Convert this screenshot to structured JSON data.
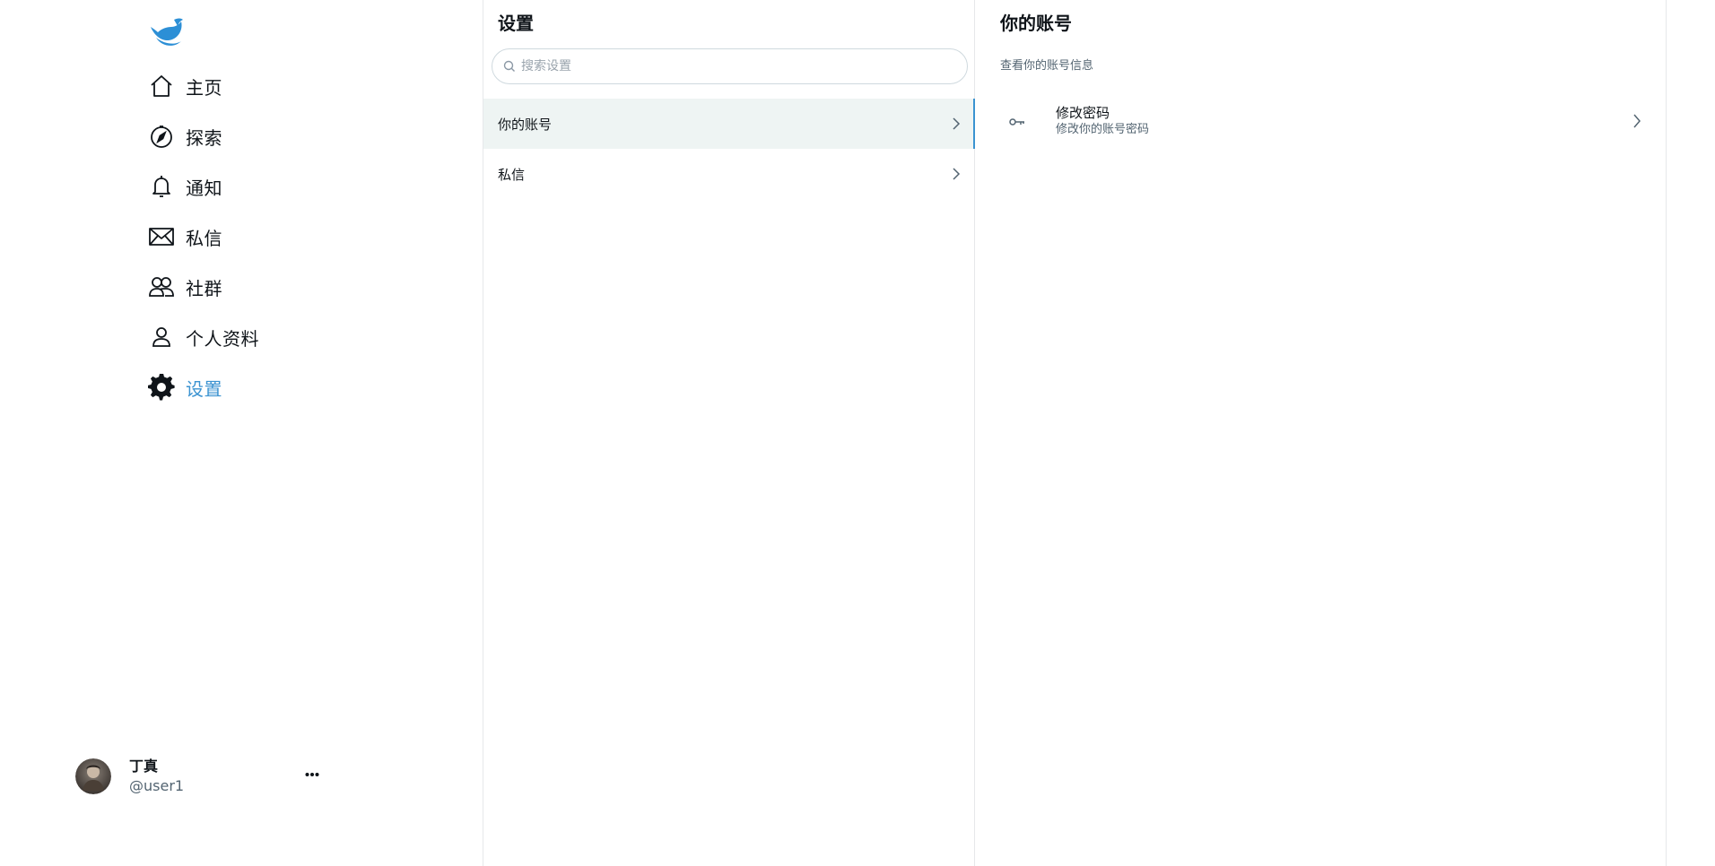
{
  "sidebar": {
    "nav": [
      {
        "label": "主页",
        "icon": "home-icon"
      },
      {
        "label": "探索",
        "icon": "compass-icon"
      },
      {
        "label": "通知",
        "icon": "bell-icon"
      },
      {
        "label": "私信",
        "icon": "mail-icon"
      },
      {
        "label": "社群",
        "icon": "community-icon"
      },
      {
        "label": "个人资料",
        "icon": "profile-icon"
      },
      {
        "label": "设置",
        "icon": "gear-icon",
        "active": true
      }
    ],
    "user": {
      "name": "丁真",
      "handle": "@user1"
    }
  },
  "settings": {
    "title": "设置",
    "search_placeholder": "搜索设置",
    "items": [
      {
        "label": "你的账号",
        "active": true
      },
      {
        "label": "私信"
      }
    ]
  },
  "detail": {
    "title": "你的账号",
    "subtitle": "查看你的账号信息",
    "rows": [
      {
        "title": "修改密码",
        "desc": "修改你的账号密码"
      }
    ]
  },
  "colors": {
    "accent": "#3b93d1",
    "active_bg": "#eef4f3",
    "border": "#e6e8ea"
  }
}
